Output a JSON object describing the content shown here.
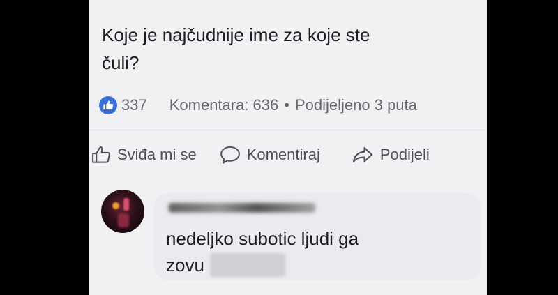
{
  "post": {
    "text_line1": "Koje je najčudnije ime za koje ste",
    "text_line2": "čuli?",
    "reactions_count": "337",
    "comments_label": "Komentara: 636",
    "shares_label": "Podijeljeno 3 puta"
  },
  "actions": {
    "like_label": "Sviđa mi se",
    "comment_label": "Komentiraj",
    "share_label": "Podijeli"
  },
  "comment": {
    "text_line1": "nedeljko subotic ljudi ga",
    "text_line2": "zovu"
  },
  "colors": {
    "background": "#000000",
    "card": "#f1f1f3",
    "like_badge": "#3b6fd8",
    "bubble": "#e9ebee"
  },
  "icons": [
    "like-badge-icon",
    "thumbs-up-icon",
    "comment-icon",
    "share-icon"
  ]
}
